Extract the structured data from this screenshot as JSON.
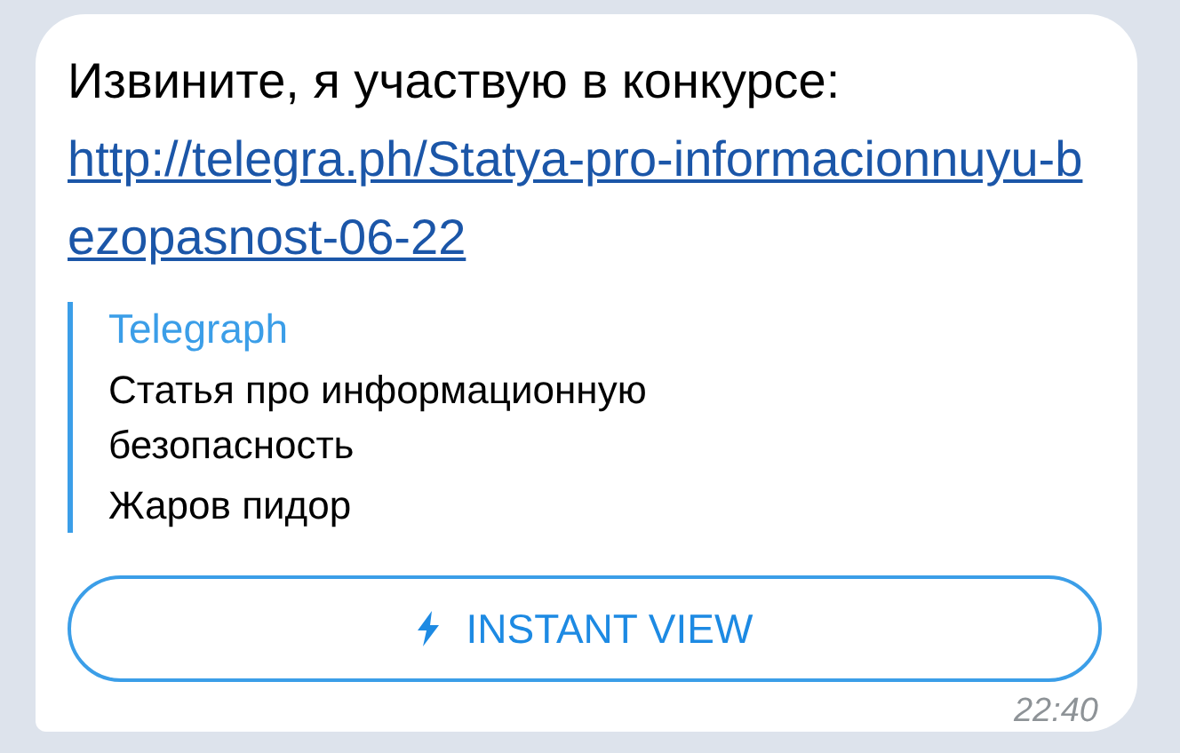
{
  "message": {
    "text": "Извините, я участвую в конкурсе:",
    "link": "http://telegra.ph/Statya-pro-informacionnuyu-bezopasnost-06-22",
    "preview": {
      "site": "Telegraph",
      "title": "Статья про информационную безопасность",
      "description": "Жаров пидор"
    },
    "button": {
      "label": "INSTANT VIEW"
    },
    "time": "22:40"
  }
}
